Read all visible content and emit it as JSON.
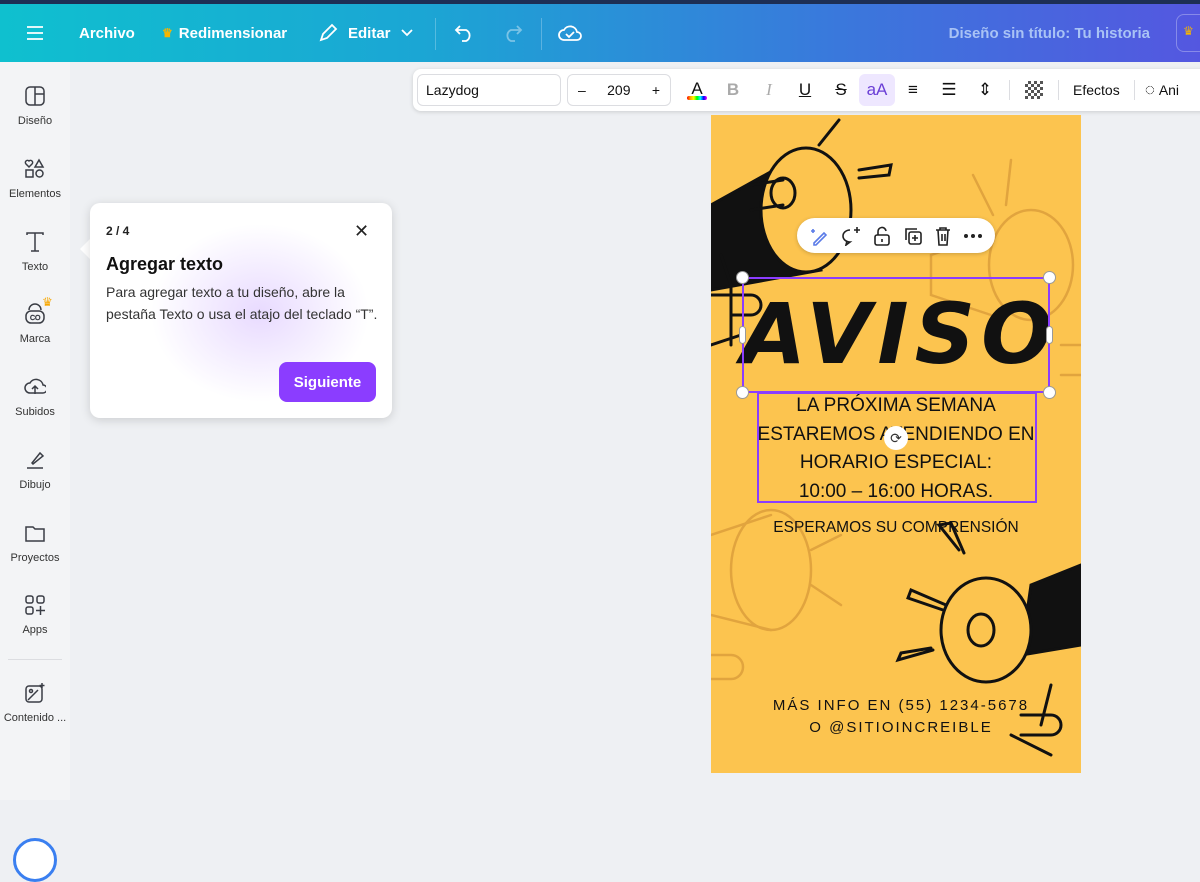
{
  "topbar": {
    "archivo": "Archivo",
    "redimensionar": "Redimensionar",
    "editar": "Editar",
    "title": "Diseño sin título: Tu historia"
  },
  "sidebar": {
    "items": [
      {
        "label": "Diseño",
        "icon": "layout-icon"
      },
      {
        "label": "Elementos",
        "icon": "shapes-icon"
      },
      {
        "label": "Texto",
        "icon": "text-icon"
      },
      {
        "label": "Marca",
        "icon": "brand-icon"
      },
      {
        "label": "Subidos",
        "icon": "upload-icon"
      },
      {
        "label": "Dibujo",
        "icon": "draw-icon"
      },
      {
        "label": "Proyectos",
        "icon": "folder-icon"
      },
      {
        "label": "Apps",
        "icon": "apps-icon"
      },
      {
        "label": "Contenido ...",
        "icon": "magic-media-icon"
      }
    ]
  },
  "toolbar": {
    "font": "Lazydog",
    "minus": "–",
    "size": "209",
    "plus": "+",
    "text_color": "A",
    "bold": "B",
    "italic": "I",
    "underline": "U",
    "strike": "S",
    "case": "aA",
    "effects": "Efectos",
    "animate": "Ani"
  },
  "popover": {
    "step": "2 / 4",
    "title": "Agregar texto",
    "body": "Para agregar texto a tu diseño, abre la pestaña Texto o usa el atajo del teclado “T”.",
    "next": "Siguiente"
  },
  "design": {
    "heading": "AVISO",
    "body_lines": [
      "LA PRÓXIMA SEMANA",
      "ESTAREMOS ATENDIENDO EN",
      "HORARIO ESPECIAL:",
      "10:00 – 16:00 HORAS."
    ],
    "closing": "ESPERAMOS SU COMPRENSIÓN",
    "info_lines": [
      "MÁS INFO EN (55) 1234-5678",
      "O @SITIOINCREIBLE"
    ],
    "background": "#fcc44f"
  },
  "colors": {
    "accent": "#8b3dff",
    "selection": "#8b3dff"
  }
}
